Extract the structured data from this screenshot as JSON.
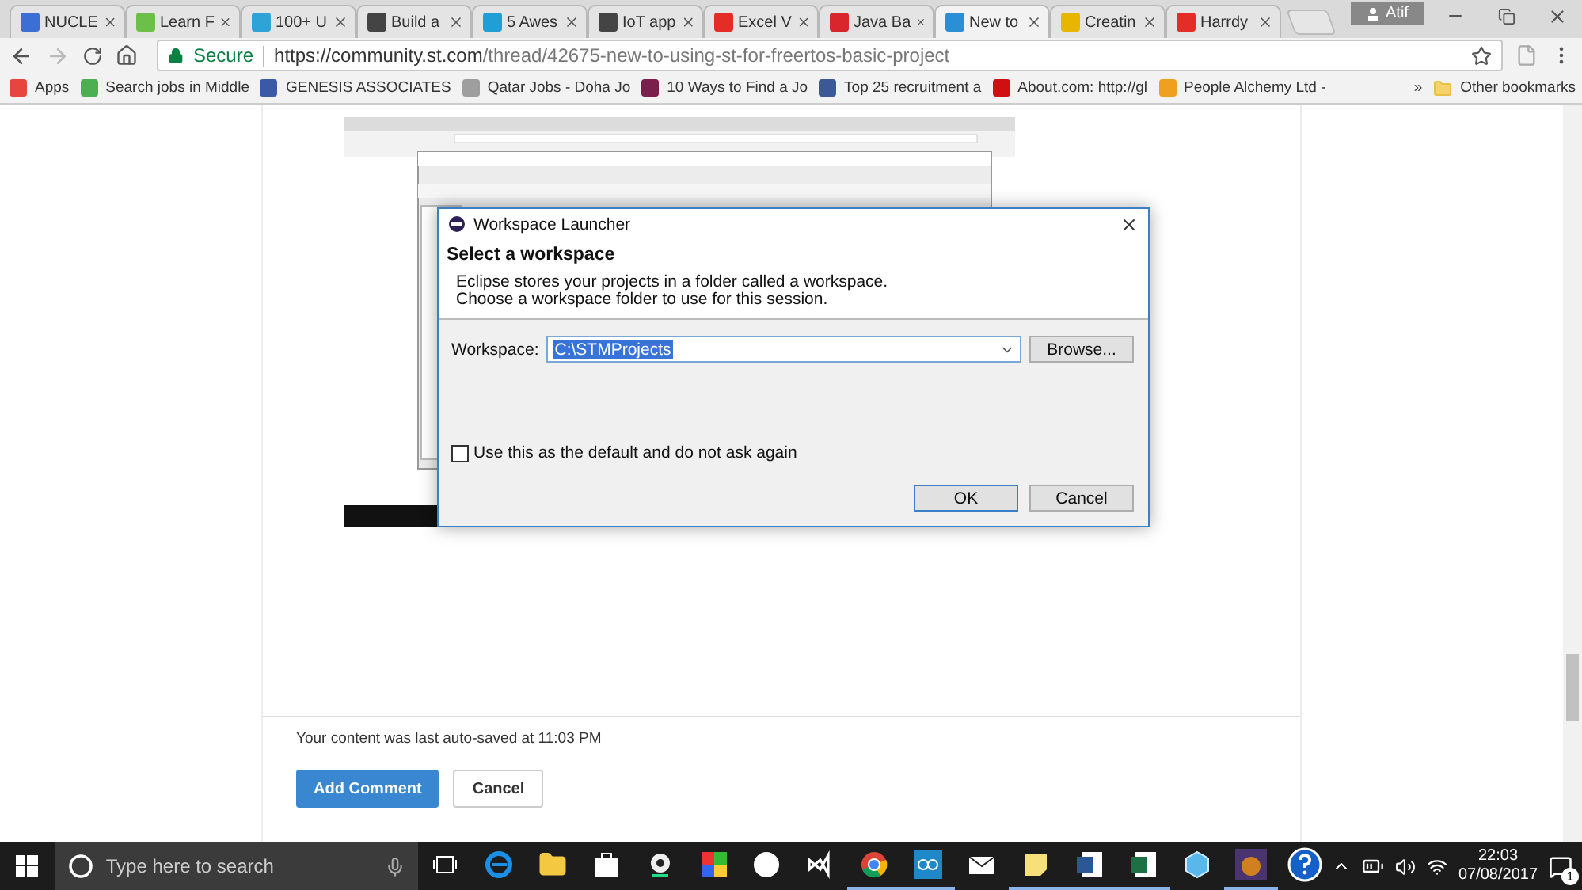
{
  "browser": {
    "tabs": [
      {
        "title": "NUCLE",
        "color": "#3b6fd4",
        "selected": false
      },
      {
        "title": "Learn F",
        "color": "#6cc04a",
        "selected": false
      },
      {
        "title": "100+ U",
        "color": "#2ea3d8",
        "selected": false
      },
      {
        "title": "Build a",
        "color": "#444444",
        "selected": false
      },
      {
        "title": "5 Awes",
        "color": "#1f9fd6",
        "selected": false
      },
      {
        "title": "IoT app",
        "color": "#444444",
        "selected": false
      },
      {
        "title": "Excel V",
        "color": "#e52d27",
        "selected": false
      },
      {
        "title": "Java Ba",
        "color": "#d9262c",
        "selected": false
      },
      {
        "title": "New to",
        "color": "#2b8fd6",
        "selected": true
      },
      {
        "title": "Creatin",
        "color": "#e8b500",
        "selected": false
      },
      {
        "title": "Harrdy",
        "color": "#e52d27",
        "selected": false
      }
    ],
    "profile": "Atif",
    "address": {
      "secure_label": "Secure",
      "url_host": "https://community.st.com",
      "url_path": "/thread/42675-new-to-using-st-for-freertos-basic-project"
    },
    "bookmarks": [
      {
        "label": "Apps",
        "color": "#e8453c"
      },
      {
        "label": "Search jobs in Middle",
        "color": "#4caf50"
      },
      {
        "label": "GENESIS ASSOCIATES",
        "color": "#3a5aa8"
      },
      {
        "label": "Qatar Jobs - Doha Jo",
        "color": "#9e9e9e"
      },
      {
        "label": "10 Ways to Find a Jo",
        "color": "#7a1f4a"
      },
      {
        "label": "Top 25 recruitment a",
        "color": "#3b5998"
      },
      {
        "label": "About.com: http://gl",
        "color": "#d01010"
      },
      {
        "label": "People Alchemy Ltd -",
        "color": "#f0a020"
      }
    ],
    "bookmarks_overflow": "»",
    "other_bookmarks": "Other bookmarks"
  },
  "dialog": {
    "title": "Workspace Launcher",
    "heading": "Select a workspace",
    "description": [
      "Eclipse stores your projects in a folder called a workspace.",
      "Choose a workspace folder to use for this session."
    ],
    "workspace_label": "Workspace:",
    "workspace_value": "C:\\STMProjects",
    "value_selected": true,
    "browse_button": "Browse...",
    "default_checkbox": {
      "label": "Use this as the default and do not ask again",
      "checked": false
    },
    "buttons": [
      {
        "label": "OK",
        "default": true
      },
      {
        "label": "Cancel",
        "default": false
      }
    ]
  },
  "page": {
    "autosave_note": "Your content was last auto-saved at 11:03 PM",
    "add_comment": "Add Comment",
    "cancel": "Cancel"
  },
  "taskbar": {
    "search_placeholder": "Type here to search",
    "apps": [
      {
        "kind": "taskview",
        "running": false
      },
      {
        "kind": "edge",
        "running": false
      },
      {
        "kind": "explorer",
        "running": false
      },
      {
        "kind": "store",
        "running": false
      },
      {
        "kind": "webcam",
        "running": false
      },
      {
        "kind": "game",
        "running": false
      },
      {
        "kind": "hp",
        "running": false
      },
      {
        "kind": "vs",
        "running": false
      },
      {
        "kind": "chrome",
        "running": true
      },
      {
        "kind": "arduino",
        "running": true
      },
      {
        "kind": "mail",
        "running": false
      },
      {
        "kind": "notes",
        "running": true
      },
      {
        "kind": "word",
        "running": true
      },
      {
        "kind": "excel",
        "running": true
      },
      {
        "kind": "box",
        "running": false
      },
      {
        "kind": "gamecard",
        "running": true
      },
      {
        "kind": "help",
        "running": false
      }
    ],
    "time": "22:03",
    "date": "07/08/2017",
    "notification_count": "1"
  }
}
